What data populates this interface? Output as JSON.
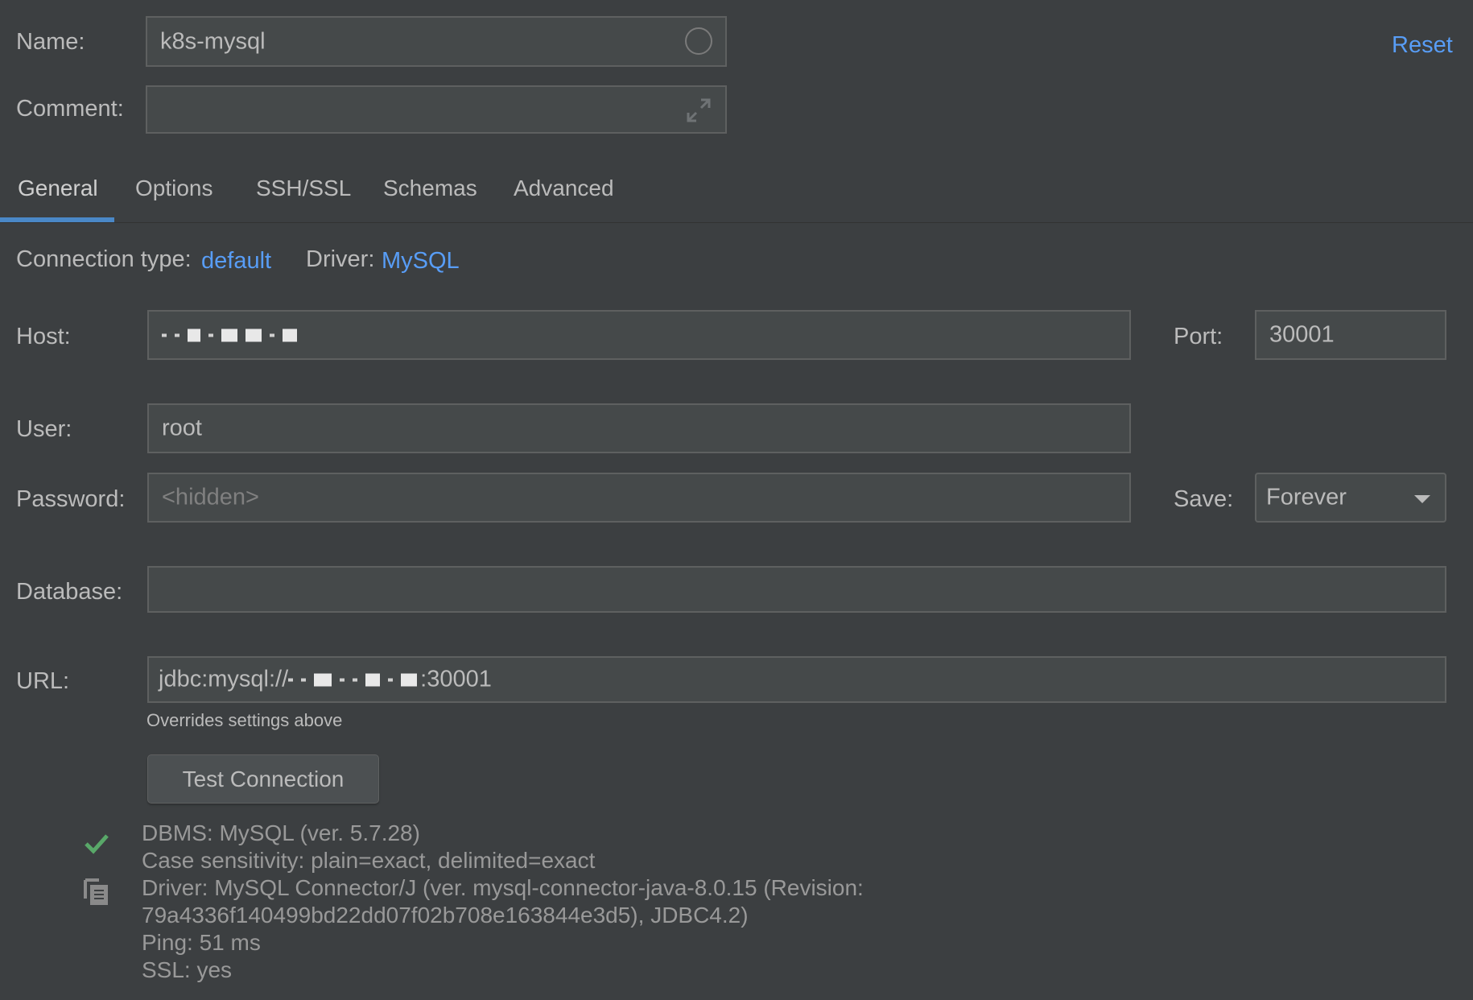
{
  "name": {
    "label": "Name:",
    "value": "k8s-mysql"
  },
  "comment": {
    "label": "Comment:",
    "value": ""
  },
  "reset_label": "Reset",
  "tabs": [
    {
      "label": "General",
      "active": true
    },
    {
      "label": "Options"
    },
    {
      "label": "SSH/SSL"
    },
    {
      "label": "Schemas"
    },
    {
      "label": "Advanced"
    }
  ],
  "connection_type": {
    "label": "Connection type:",
    "value": "default"
  },
  "driver": {
    "label": "Driver:",
    "value": "MySQL"
  },
  "host": {
    "label": "Host:"
  },
  "port": {
    "label": "Port:",
    "value": "30001"
  },
  "user": {
    "label": "User:",
    "value": "root"
  },
  "password": {
    "label": "Password:",
    "placeholder": "<hidden>"
  },
  "save": {
    "label": "Save:",
    "value": "Forever"
  },
  "database": {
    "label": "Database:",
    "value": ""
  },
  "url": {
    "label": "URL:",
    "prefix": "jdbc:mysql://",
    "suffix": ":30001",
    "hint": "Overrides settings above"
  },
  "test_button_label": "Test Connection",
  "result": {
    "status_icon": "check-icon",
    "copy_icon": "copy-icon",
    "lines": [
      "DBMS: MySQL (ver. 5.7.28)",
      "Case sensitivity: plain=exact, delimited=exact",
      "Driver: MySQL Connector/J (ver. mysql-connector-java-8.0.15 (Revision:",
      "79a4336f140499bd22dd07f02b708e163844e3d5), JDBC4.2)",
      "Ping: 51 ms",
      "SSL: yes"
    ]
  },
  "colors": {
    "background": "#3c3f41",
    "accent": "#589df6",
    "field_bg": "#45494a",
    "success": "#59a869"
  }
}
